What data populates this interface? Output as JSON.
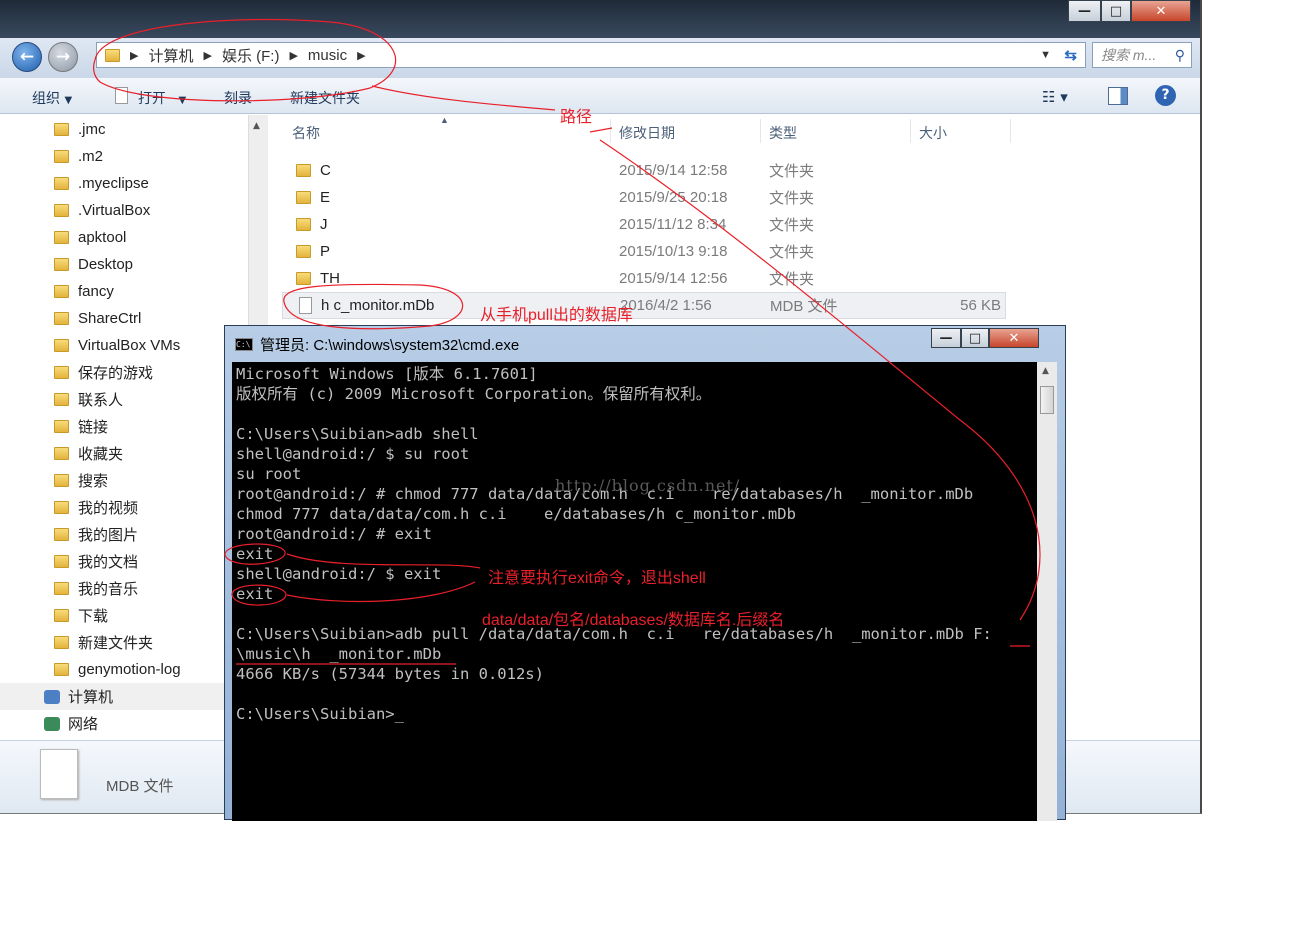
{
  "window": {
    "minimize": "—",
    "maximize": "□",
    "close": "✕"
  },
  "address": {
    "crumbs": [
      "计算机",
      "娱乐 (F:)",
      "music"
    ],
    "search_placeholder": "搜索 m..."
  },
  "toolbar": {
    "organize": "组织",
    "open": "打开",
    "burn": "刻录",
    "new_folder": "新建文件夹"
  },
  "sidebar": {
    "items": [
      ".jmc",
      ".m2",
      ".myeclipse",
      ".VirtualBox",
      "apktool",
      "Desktop",
      "fancy",
      "ShareCtrl",
      "VirtualBox VMs",
      "保存的游戏",
      "联系人",
      "链接",
      "收藏夹",
      "搜索",
      "我的视频",
      "我的图片",
      "我的文档",
      "我的音乐",
      "下载",
      "新建文件夹",
      "genymotion-log"
    ],
    "computer": "计算机",
    "network": "网络"
  },
  "columns": {
    "name": "名称",
    "date": "修改日期",
    "type": "类型",
    "size": "大小"
  },
  "files": [
    {
      "name": "C",
      "date": "2015/9/14 12:58",
      "type": "文件夹",
      "size": ""
    },
    {
      "name": "E",
      "date": "2015/9/25 20:18",
      "type": "文件夹",
      "size": ""
    },
    {
      "name": "J",
      "date": "2015/11/12 8:34",
      "type": "文件夹",
      "size": ""
    },
    {
      "name": "P",
      "date": "2015/10/13 9:18",
      "type": "文件夹",
      "size": ""
    },
    {
      "name": "TH",
      "date": "2015/9/14 12:56",
      "type": "文件夹",
      "size": ""
    },
    {
      "name": "h c_monitor.mDb",
      "date": "2016/4/2 1:56",
      "type": "MDB 文件",
      "size": "56 KB"
    }
  ],
  "details": {
    "filetype": "MDB 文件"
  },
  "cmd": {
    "title": "管理员: C:\\windows\\system32\\cmd.exe",
    "lines": [
      "Microsoft Windows [版本 6.1.7601]",
      "版权所有 (c) 2009 Microsoft Corporation。保留所有权利。",
      "",
      "C:\\Users\\Suibian>adb shell",
      "shell@android:/ $ su root",
      "su root",
      "root@android:/ # chmod 777 data/data/com.h  c.i    re/databases/h  _monitor.mDb",
      "chmod 777 data/data/com.h c.i    e/databases/h c_monitor.mDb",
      "root@android:/ # exit",
      "exit",
      "shell@android:/ $ exit",
      "exit",
      "",
      "C:\\Users\\Suibian>adb pull /data/data/com.h  c.i   re/databases/h  _monitor.mDb F:",
      "\\music\\h  _monitor.mDb",
      "4666 KB/s (57344 bytes in 0.012s)",
      "",
      "C:\\Users\\Suibian>_"
    ],
    "watermark": "http://blog.csdn.net/"
  },
  "annotations": {
    "path": "路径",
    "db_pulled": "从手机pull出的数据库",
    "exit_note": "注意要执行exit命令，退出shell",
    "path_format": "data/data/包名/databases/数据库名.后缀名"
  },
  "colors": {
    "annotation": "#e8202a",
    "console_bg": "#000000",
    "console_text": "#c0c0c0"
  }
}
